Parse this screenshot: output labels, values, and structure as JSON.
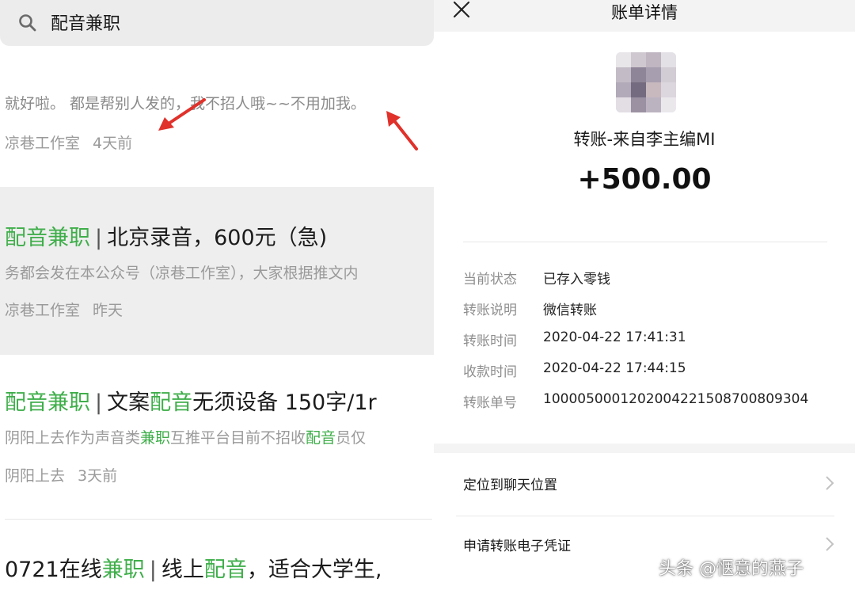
{
  "left": {
    "search": {
      "query": "配音兼职"
    },
    "snippet": "就好啦。 都是帮别人发的，我不招人哦~~不用加我。",
    "snippet_meta": {
      "source": "凉巷工作室",
      "time": "4天前"
    },
    "results": [
      {
        "title_hl": "配音兼职",
        "title_rest": "北京录音，600元（急)",
        "desc": "务都会发在本公众号（凉巷工作室），大家根据推文内",
        "source": "凉巷工作室",
        "time": "昨天"
      },
      {
        "title_hl": "配音兼职",
        "title_mid1": "文案",
        "title_hl2": "配音",
        "title_rest": "无须设备 150字/1r",
        "desc_a": "阴阳上去作为声音类",
        "desc_hl1": "兼职",
        "desc_b": "互推平台目前不招收",
        "desc_hl2": "配音",
        "desc_c": "员仅",
        "source": "阴阳上去",
        "time": "3天前"
      },
      {
        "title_a": "0721在线",
        "title_hl": "兼职",
        "title_mid": "线上",
        "title_hl2": "配音",
        "title_rest": "，适合大学生,"
      }
    ],
    "separator": "|"
  },
  "right": {
    "header_title": "账单详情",
    "transfer_from": "转账-来自李主编MI",
    "amount": "+500.00",
    "details": [
      {
        "label": "当前状态",
        "value": "已存入零钱"
      },
      {
        "label": "转账说明",
        "value": "微信转账"
      },
      {
        "label": "转账时间",
        "value": "2020-04-22 17:41:31"
      },
      {
        "label": "收款时间",
        "value": "2020-04-22 17:44:15"
      },
      {
        "label": "转账单号",
        "value": "1000050001202004221508700809304"
      }
    ],
    "actions": [
      {
        "label": "定位到聊天位置"
      },
      {
        "label": "申请转账电子凭证"
      }
    ]
  },
  "watermark": "头条 @惬意的燕子",
  "colors": {
    "highlight_green": "#3fae4a",
    "arrow_red": "#e0312b",
    "header_bg": "#f3f3f3"
  },
  "icons": [
    "search-icon",
    "close-icon",
    "chevron-right-icon"
  ]
}
